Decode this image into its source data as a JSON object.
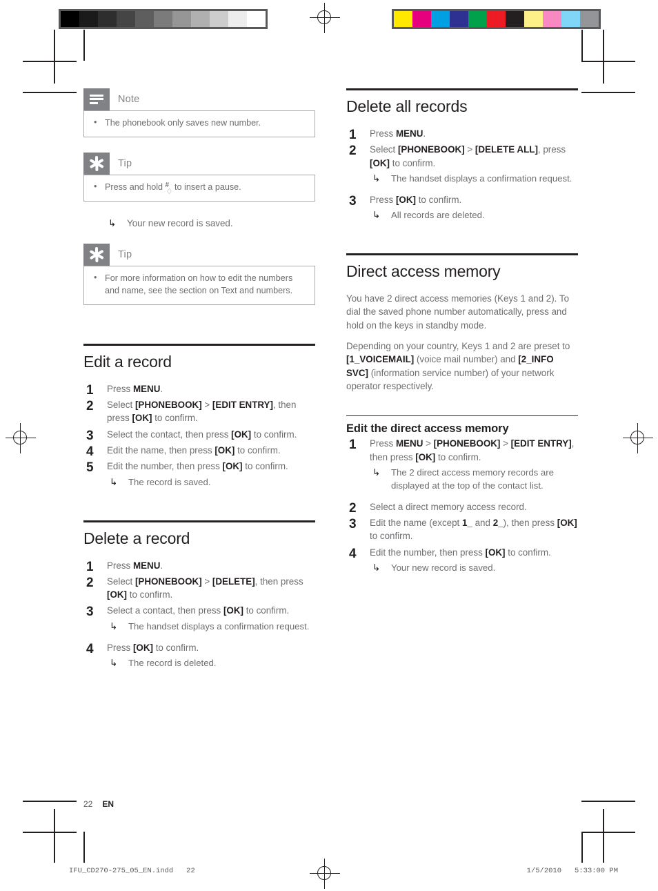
{
  "document": {
    "folio": {
      "page_number": "22",
      "language": "EN"
    },
    "slug": {
      "filename": "IFU_CD270-275_05_EN.indd",
      "page": "22",
      "date": "1/5/2010",
      "time": "5:33:00 PM"
    }
  },
  "calibration": {
    "grayscale_swatches": [
      "#000000",
      "#1a1a1a",
      "#2e2e2e",
      "#454545",
      "#5e5e5e",
      "#7b7b7b",
      "#969696",
      "#b0b0b0",
      "#cccccc",
      "#ededed",
      "#ffffff"
    ],
    "color_swatches": [
      "#ffe900",
      "#e6007e",
      "#00a0e3",
      "#2e3192",
      "#00a14b",
      "#ed1c24",
      "#231f20",
      "#fdf089",
      "#f989c3",
      "#7fd6f7",
      "#939598"
    ]
  },
  "left_column": {
    "note_callout": {
      "icon": "note-lines-icon",
      "title": "Note",
      "items": [
        "The phonebook only saves new number."
      ]
    },
    "tip_callout_1": {
      "icon": "tip-asterisk-icon",
      "title": "Tip",
      "text_before": "Press and hold",
      "key_glyph": "hash-pause-key",
      "text_after": "to insert a pause."
    },
    "standalone_result": "Your new record is saved.",
    "tip_callout_2": {
      "icon": "tip-asterisk-icon",
      "title": "Tip",
      "items": [
        "For more information on how to edit the numbers and name, see the section on Text and numbers."
      ]
    },
    "section_edit": {
      "title": "Edit a record",
      "steps": [
        {
          "num": "1",
          "html": "Press <b>MENU</b>."
        },
        {
          "num": "2",
          "html": "Select <b>[PHONEBOOK]</b> &gt; <b>[EDIT ENTRY]</b>, then press <b>[OK]</b> to confirm."
        },
        {
          "num": "3",
          "html": "Select the contact, then press <b>[OK]</b> to confirm."
        },
        {
          "num": "4",
          "html": "Edit the name, then press <b>[OK]</b> to confirm."
        },
        {
          "num": "5",
          "html": "Edit the number, then press <b>[OK]</b> to confirm.",
          "result": "The record is saved."
        }
      ]
    },
    "section_delete": {
      "title": "Delete a record",
      "steps": [
        {
          "num": "1",
          "html": "Press <b>MENU</b>."
        },
        {
          "num": "2",
          "html": "Select <b>[PHONEBOOK]</b> &gt; <b>[DELETE]</b>, then press <b>[OK]</b> to confirm."
        },
        {
          "num": "3",
          "html": "Select a contact, then press <b>[OK]</b> to confirm.",
          "result": "The handset displays a confirmation request."
        },
        {
          "num": "4",
          "html": "Press <b>[OK]</b> to confirm.",
          "result": "The record is deleted."
        }
      ]
    }
  },
  "right_column": {
    "section_delete_all": {
      "title": "Delete all records",
      "steps": [
        {
          "num": "1",
          "html": "Press <b>MENU</b>."
        },
        {
          "num": "2",
          "html": "Select <b>[PHONEBOOK]</b> &gt; <b>[DELETE ALL]</b>, press <b>[OK]</b> to confirm.",
          "result": "The handset displays a confirmation request."
        },
        {
          "num": "3",
          "html": "Press <b>[OK]</b> to confirm.",
          "result": "All records are deleted."
        }
      ]
    },
    "section_direct_access": {
      "title": "Direct access memory",
      "paragraphs": [
        "You have 2 direct access memories (Keys 1 and 2). To dial the saved phone number automatically, press and hold on the keys in standby mode.",
        "Depending on your country, Keys 1 and 2 are preset to <b>[1_VOICEMAIL]</b> (voice mail number) and <b>[2_INFO SVC]</b> (information service number) of your network operator respectively."
      ],
      "subsection": {
        "title": "Edit the direct access memory",
        "steps": [
          {
            "num": "1",
            "html": "Press <b>MENU</b> &gt; <b>[PHONEBOOK]</b> &gt; <b>[EDIT ENTRY]</b>, then press <b>[OK]</b> to confirm.",
            "result": "The 2 direct access memory records are displayed at the top of the contact list."
          },
          {
            "num": "2",
            "html": "Select a direct memory access record."
          },
          {
            "num": "3",
            "html": "Edit the name (except <b>1_</b> and <b>2_</b>), then press <b>[OK]</b> to confirm."
          },
          {
            "num": "4",
            "html": "Edit the number, then press <b>[OK]</b> to confirm.",
            "result": "Your new record is saved."
          }
        ]
      }
    }
  }
}
